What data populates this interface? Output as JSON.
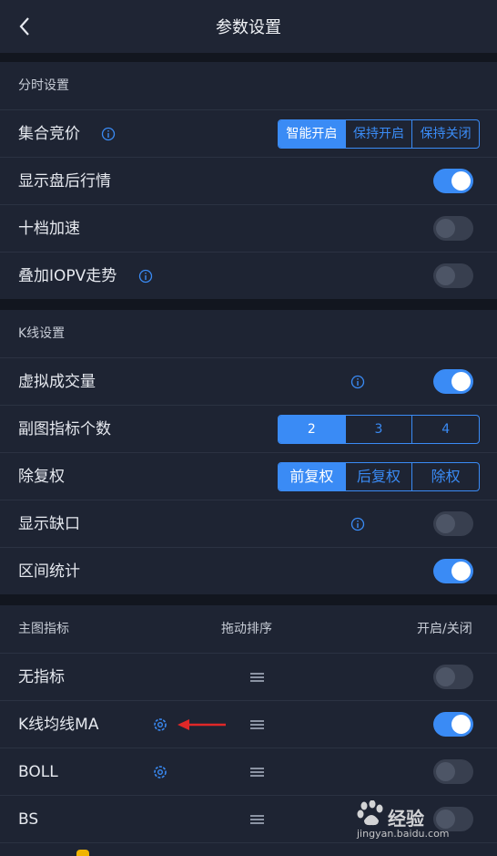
{
  "header": {
    "title": "参数设置"
  },
  "sections": {
    "fenshi": {
      "title": "分时设置",
      "rows": {
        "jihe": {
          "label": "集合竞价",
          "options": [
            "智能开启",
            "保持开启",
            "保持关闭"
          ]
        },
        "panhou": {
          "label": "显示盘后行情",
          "on": true
        },
        "shidang": {
          "label": "十档加速",
          "on": false
        },
        "iopv": {
          "label": "叠加IOPV走势",
          "on": false
        }
      }
    },
    "kline": {
      "title": "K线设置",
      "rows": {
        "xuni": {
          "label": "虚拟成交量",
          "on": true
        },
        "futu": {
          "label": "副图指标个数",
          "options": [
            "2",
            "3",
            "4"
          ]
        },
        "fuquan": {
          "label": "除复权",
          "options": [
            "前复权",
            "后复权",
            "除权"
          ]
        },
        "quekou": {
          "label": "显示缺口",
          "on": false
        },
        "qujian": {
          "label": "区间统计",
          "on": true
        }
      }
    },
    "main_indicator": {
      "headers": {
        "name": "主图指标",
        "sort": "拖动排序",
        "toggle": "开启/关闭"
      },
      "rows": [
        {
          "label": "无指标",
          "on": false
        },
        {
          "label": "K线均线MA",
          "on": true
        },
        {
          "label": "BOLL",
          "on": false
        },
        {
          "label": "BS",
          "on": false
        }
      ]
    }
  },
  "watermark": {
    "brand": "经验",
    "site": "jingyan.baidu.com"
  },
  "colors": {
    "accent": "#3a8bf5",
    "background": "#1e2433",
    "band": "#12161f"
  }
}
